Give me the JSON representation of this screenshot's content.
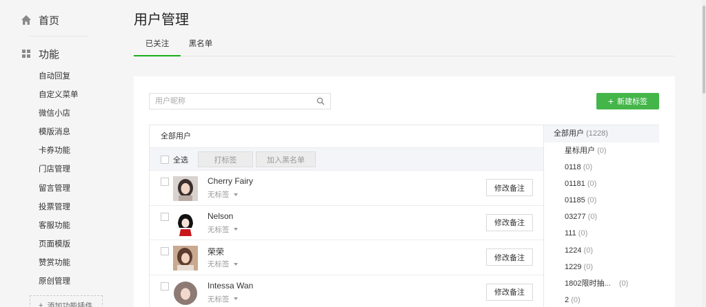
{
  "sidebar": {
    "home_label": "首页",
    "group_label": "功能",
    "items": [
      "自动回复",
      "自定义菜单",
      "微信小店",
      "模版消息",
      "卡券功能",
      "门店管理",
      "留言管理",
      "投票管理",
      "客服功能",
      "页面模版",
      "赞赏功能",
      "原创管理"
    ],
    "add_plugin_label": "添加功能插件"
  },
  "page": {
    "title": "用户管理",
    "tabs": [
      {
        "label": "已关注",
        "active": true
      },
      {
        "label": "黑名单",
        "active": false
      }
    ]
  },
  "search": {
    "placeholder": "用户昵称"
  },
  "new_tag_label": "新建标签",
  "table": {
    "header": "全部用户",
    "select_all": "全选",
    "tag_button": "打标签",
    "blacklist_button": "加入黑名单",
    "remark_label": "修改备注",
    "rows": [
      {
        "name": "Cherry Fairy",
        "tag": "无标签"
      },
      {
        "name": "Nelson",
        "tag": "无标签"
      },
      {
        "name": "荣荣",
        "tag": "无标签"
      },
      {
        "name": "Intessa Wan",
        "tag": "无标签"
      }
    ]
  },
  "tags": {
    "all": {
      "label": "全部用户",
      "count": "(1228)"
    },
    "items": [
      {
        "label": "星标用户",
        "count": "(0)"
      },
      {
        "label": "0118",
        "count": "(0)"
      },
      {
        "label": "01181",
        "count": "(0)"
      },
      {
        "label": "01185",
        "count": "(0)"
      },
      {
        "label": "03277",
        "count": "(0)"
      },
      {
        "label": "111",
        "count": "(0)"
      },
      {
        "label": "1224",
        "count": "(0)"
      },
      {
        "label": "1229",
        "count": "(0)"
      },
      {
        "label": "1802限时抽...",
        "count": "(0)"
      },
      {
        "label": "2",
        "count": "(0)"
      }
    ]
  },
  "colors": {
    "accent": "#44b549",
    "tab_underline": "#1aad19"
  }
}
